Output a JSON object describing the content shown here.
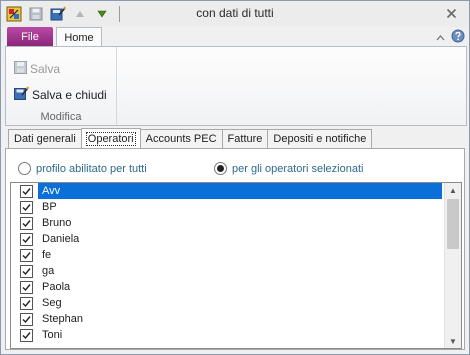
{
  "window": {
    "title": "con dati di tutti"
  },
  "ribbon": {
    "file_tab": "File",
    "home_tab": "Home",
    "save_label": "Salva",
    "save_close_label": "Salva e chiudi",
    "group_label": "Modifica"
  },
  "tabs": [
    "Dati generali",
    "Operatori",
    "Accounts PEC",
    "Fatture",
    "Depositi e notifiche"
  ],
  "radios": {
    "all_label": "profilo abilitato per tutti",
    "selected_label": "per gli operatori selezionati",
    "selected": "selected"
  },
  "operators": [
    {
      "name": "Avv",
      "checked": true,
      "selected": true
    },
    {
      "name": "BP",
      "checked": true
    },
    {
      "name": "Bruno",
      "checked": true
    },
    {
      "name": "Daniela",
      "checked": true
    },
    {
      "name": "fe",
      "checked": true
    },
    {
      "name": "ga",
      "checked": true
    },
    {
      "name": "Paola",
      "checked": true
    },
    {
      "name": "Seg",
      "checked": true
    },
    {
      "name": "Stephan",
      "checked": true
    },
    {
      "name": "Toni",
      "checked": true
    }
  ],
  "colors": {
    "file_tab": "#8a2478",
    "selection": "#0a6fd8",
    "radio_text": "#2d6b8c"
  }
}
